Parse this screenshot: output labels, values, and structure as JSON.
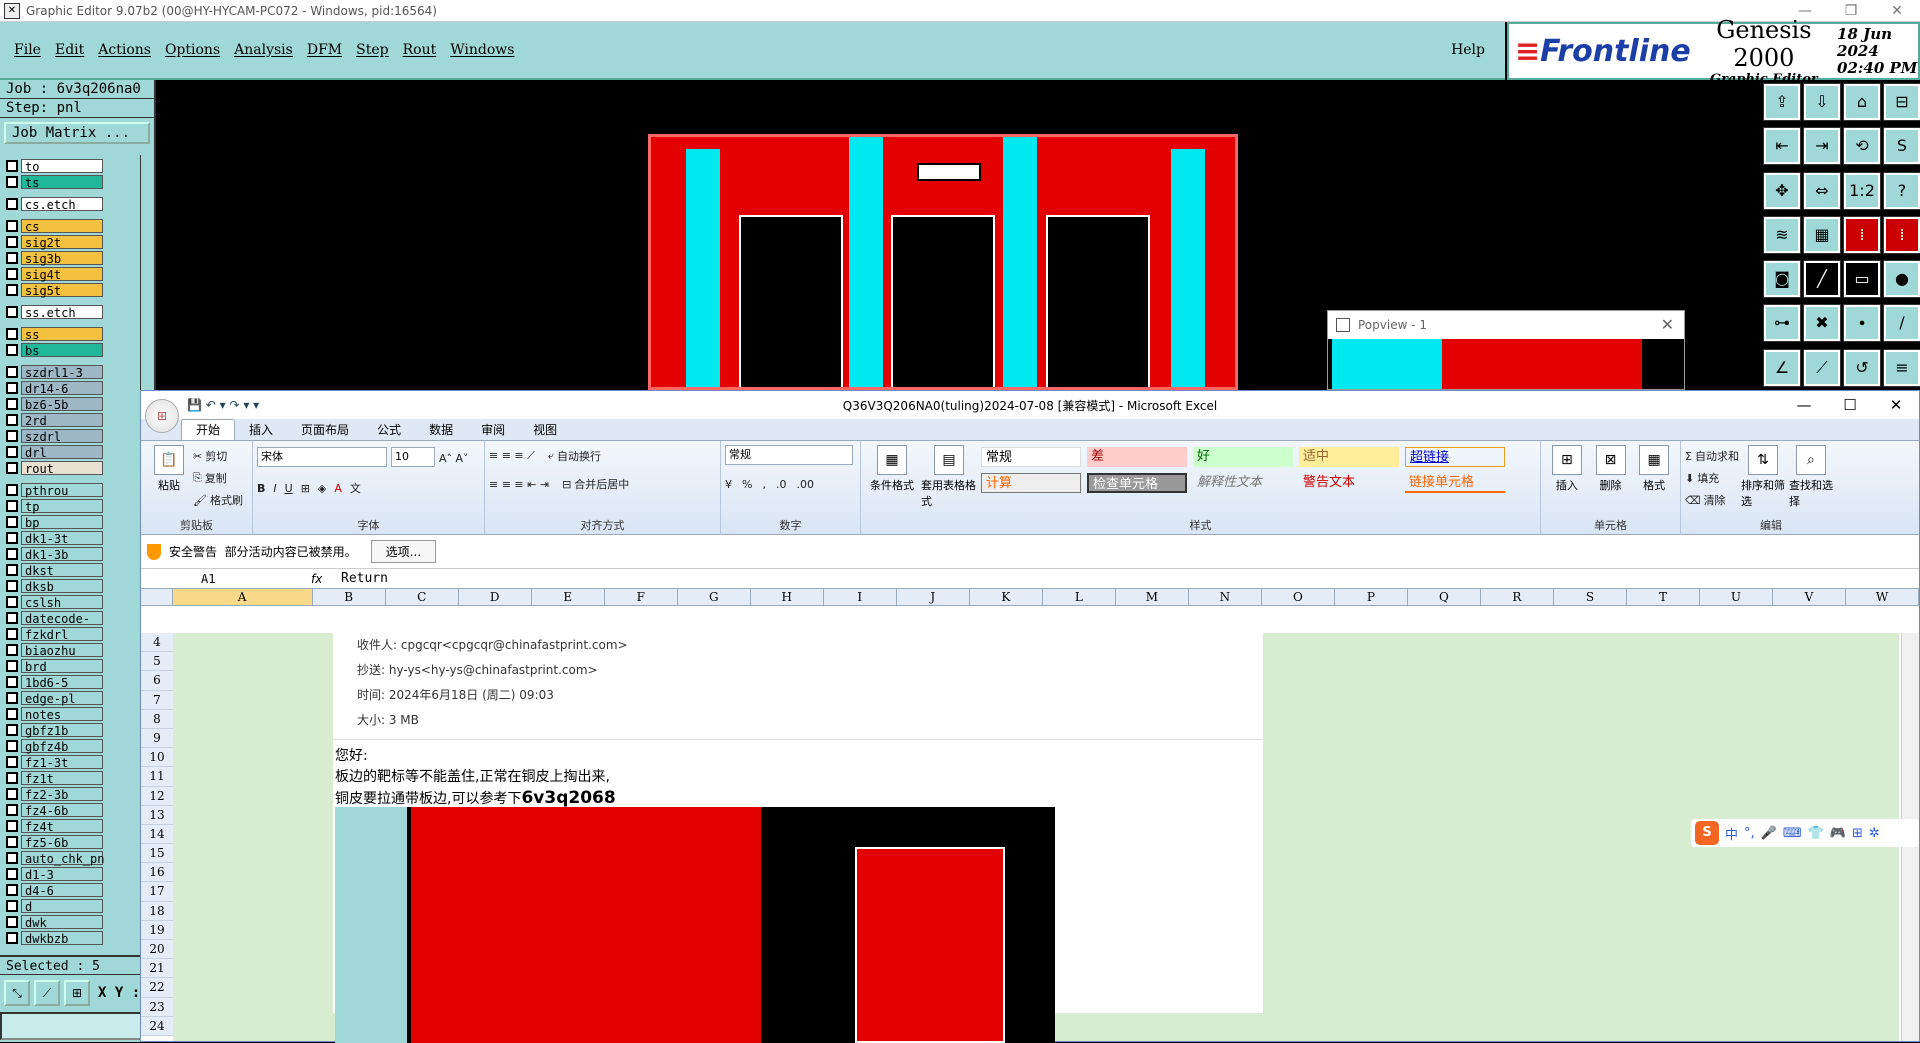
{
  "genesis": {
    "title": "Graphic Editor 9.07b2 (00@HY-HYCAM-PC072 - Windows, pid:16564)",
    "menu": [
      "File",
      "Edit",
      "Actions",
      "Options",
      "Analysis",
      "DFM",
      "Step",
      "Rout",
      "Windows"
    ],
    "help": "Help",
    "brand": {
      "logo": "Frontline",
      "product": "Genesis 2000",
      "sub": "Graphic Editor",
      "date": "18 Jun 2024",
      "time": "02:40 PM"
    },
    "job": "Job : 6v3q206na0",
    "step": "Step: pnl",
    "job_matrix": "Job Matrix ...",
    "layers_group1": [
      {
        "name": "to",
        "color": "#ffffff"
      },
      {
        "name": "ts",
        "color": "#20b898"
      }
    ],
    "layers_group2": [
      {
        "name": "cs.etch",
        "color": "#ffffff"
      }
    ],
    "layers_group3": [
      {
        "name": "cs",
        "color": "#f4c040"
      },
      {
        "name": "sig2t",
        "color": "#f4c040"
      },
      {
        "name": "sig3b",
        "color": "#f4c040"
      },
      {
        "name": "sig4t",
        "color": "#f4c040"
      },
      {
        "name": "sig5t",
        "color": "#f4c040"
      }
    ],
    "layers_group4": [
      {
        "name": "ss.etch",
        "color": "#ffffff"
      }
    ],
    "layers_group5": [
      {
        "name": "ss",
        "color": "#f4c040"
      },
      {
        "name": "bs",
        "color": "#20b898"
      }
    ],
    "layers_group6": [
      {
        "name": "szdrl1-3",
        "color": "#9db8c4"
      },
      {
        "name": "dr14-6",
        "color": "#9db8c4"
      },
      {
        "name": "bz6-5b",
        "color": "#9db8c4"
      },
      {
        "name": "2rd",
        "color": "#9db8c4"
      },
      {
        "name": "szdrl",
        "color": "#9db8c4"
      },
      {
        "name": "drl",
        "color": "#9db8c4"
      },
      {
        "name": "rout",
        "color": "#e8e0d0"
      }
    ],
    "layers_group7": [
      {
        "name": "pthrou"
      },
      {
        "name": "tp"
      },
      {
        "name": "bp"
      },
      {
        "name": "dk1-3t"
      },
      {
        "name": "dk1-3b"
      },
      {
        "name": "dkst"
      },
      {
        "name": "dksb"
      },
      {
        "name": "cslsh"
      },
      {
        "name": "datecode-to"
      },
      {
        "name": "fzkdrl"
      },
      {
        "name": "biaozhu"
      },
      {
        "name": "brd"
      },
      {
        "name": "1bd6-5"
      },
      {
        "name": "edge-pl"
      },
      {
        "name": "notes"
      },
      {
        "name": "gbfz1b"
      },
      {
        "name": "gbfz4b"
      },
      {
        "name": "fz1-3t"
      },
      {
        "name": "fz1t"
      },
      {
        "name": "fz2-3b"
      },
      {
        "name": "fz4-6b"
      },
      {
        "name": "fz4t"
      },
      {
        "name": "fz5-6b"
      },
      {
        "name": "auto_chk_pn"
      },
      {
        "name": "d1-3"
      },
      {
        "name": "d4-6"
      },
      {
        "name": "d"
      },
      {
        "name": "dwk"
      },
      {
        "name": "dwkbzb"
      }
    ],
    "selected": "Selected : 5",
    "xy_label": "X Y :",
    "popview_title": "Popview - 1"
  },
  "excel": {
    "title": "Q36V3Q206NA0(tuling)2024-07-08  [兼容模式] - Microsoft Excel",
    "tabs": [
      "开始",
      "插入",
      "页面布局",
      "公式",
      "数据",
      "审阅",
      "视图"
    ],
    "clipboard": {
      "paste": "粘贴",
      "cut": "剪切",
      "copy": "复制",
      "format_painter": "格式刷",
      "label": "剪贴板"
    },
    "font": {
      "name": "宋体",
      "size": "10",
      "label": "字体"
    },
    "align": {
      "wrap": "自动换行",
      "merge": "合并后居中",
      "label": "对齐方式"
    },
    "number": {
      "format": "常规",
      "label": "数字"
    },
    "styles": {
      "cond": "条件格式",
      "table": "套用表格格式",
      "normal": "常规",
      "bad": "差",
      "good": "好",
      "neutral": "适中",
      "hyperlink": "超链接",
      "calc": "计算",
      "check": "检查单元格",
      "explain": "解释性文本",
      "warn": "警告文本",
      "linked": "链接单元格",
      "label": "样式"
    },
    "cells": {
      "insert": "插入",
      "delete": "删除",
      "format": "格式",
      "label": "单元格"
    },
    "edit": {
      "autosum": "自动求和",
      "fill": "填充",
      "clear": "清除",
      "sort": "排序和筛选",
      "find": "查找和选择",
      "label": "编辑"
    },
    "security": {
      "title": "安全警告",
      "msg": "部分活动内容已被禁用。",
      "options": "选项..."
    },
    "namebox": "A1",
    "fx": "fx",
    "formula": "Return",
    "columns": [
      "A",
      "B",
      "C",
      "D",
      "E",
      "F",
      "G",
      "H",
      "I",
      "J",
      "K",
      "L",
      "M",
      "N",
      "O",
      "P",
      "Q",
      "R",
      "S",
      "T",
      "U",
      "V",
      "W"
    ],
    "rows": [
      "4",
      "5",
      "6",
      "7",
      "8",
      "9",
      "10",
      "11",
      "12",
      "13",
      "14",
      "15",
      "16",
      "17",
      "18",
      "19",
      "20",
      "21",
      "22",
      "23",
      "24"
    ],
    "mail": {
      "to": "收件人: cpgcqr<cpgcqr@chinafastprint.com>",
      "cc": "抄送: hy-ys<hy-ys@chinafastprint.com>",
      "time": "时间: 2024年6月18日 (周二) 09:03",
      "size": "大小: 3 MB"
    },
    "body": {
      "greet": "您好:",
      "line1": "板边的靶标等不能盖住,正常在铜皮上掏出来,",
      "line2": "铜皮要拉通带板边,可以参考下",
      "ref": "6v3q2068"
    },
    "ime": [
      "S",
      "中",
      "°,",
      "🎤",
      "⌨",
      "👕",
      "🎮",
      "⊞",
      "✲"
    ]
  }
}
